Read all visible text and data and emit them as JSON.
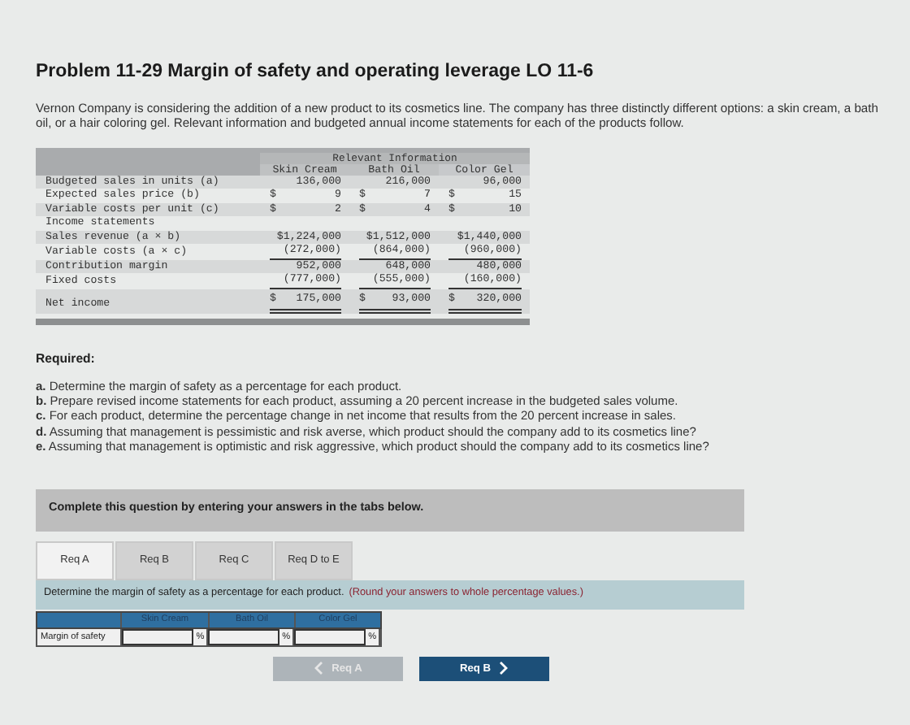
{
  "title": "Problem 11-29 Margin of safety and operating leverage LO 11-6",
  "intro": "Vernon Company is considering the addition of a new product to its cosmetics line. The company has three distinctly different options: a skin cream, a bath oil, or a hair coloring gel. Relevant information and budgeted annual income statements for each of the products follow.",
  "info_table": {
    "group_heading": "Relevant Information",
    "columns": [
      "Skin Cream",
      "Bath Oil",
      "Color Gel"
    ],
    "rows": [
      {
        "label": "Budgeted sales in units (a)",
        "underlined": false,
        "double_underlined": false,
        "values": [
          {
            "value": "136,000"
          },
          {
            "value": "216,000"
          },
          {
            "value": "96,000"
          }
        ]
      },
      {
        "label": "Expected sales price (b)",
        "underlined": false,
        "double_underlined": false,
        "values": [
          {
            "currency": "$",
            "value": "9"
          },
          {
            "currency": "$",
            "value": "7"
          },
          {
            "currency": "$",
            "value": "15"
          }
        ]
      },
      {
        "label": "Variable costs per unit (c)",
        "underlined": false,
        "double_underlined": false,
        "values": [
          {
            "currency": "$",
            "value": "2"
          },
          {
            "currency": "$",
            "value": "4"
          },
          {
            "currency": "$",
            "value": "10"
          }
        ]
      },
      {
        "label": "Income statements"
      },
      {
        "label": "Sales revenue (a × b)",
        "underlined": false,
        "double_underlined": false,
        "values": [
          {
            "value": "$1,224,000"
          },
          {
            "value": "$1,512,000"
          },
          {
            "value": "$1,440,000"
          }
        ]
      },
      {
        "label": "Variable costs (a × c)",
        "underlined": true,
        "double_underlined": false,
        "values": [
          {
            "value": "(272,000)"
          },
          {
            "value": "(864,000)"
          },
          {
            "value": "(960,000)"
          }
        ]
      },
      {
        "label": "Contribution margin",
        "underlined": false,
        "double_underlined": false,
        "values": [
          {
            "value": "952,000"
          },
          {
            "value": "648,000"
          },
          {
            "value": "480,000"
          }
        ]
      },
      {
        "label": "Fixed costs",
        "underlined": true,
        "double_underlined": false,
        "values": [
          {
            "value": "(777,000)"
          },
          {
            "value": "(555,000)"
          },
          {
            "value": "(160,000)"
          }
        ]
      },
      {
        "label": "Net income",
        "underlined": false,
        "double_underlined": true,
        "values": [
          {
            "currency": "$",
            "value": "175,000"
          },
          {
            "currency": "$",
            "value": "93,000"
          },
          {
            "currency": "$",
            "value": "320,000"
          }
        ]
      }
    ]
  },
  "required_heading": "Required:",
  "requirements": [
    {
      "letter": "a.",
      "text": "Determine the margin of safety as a percentage for each product."
    },
    {
      "letter": "b.",
      "text": "Prepare revised income statements for each product, assuming a 20 percent increase in the budgeted sales volume."
    },
    {
      "letter": "c.",
      "text": "For each product, determine the percentage change in net income that results from the 20 percent  increase in sales."
    },
    {
      "letter": "d.",
      "text": "Assuming that management is pessimistic and risk averse, which product should the company add to its cosmetics line?"
    },
    {
      "letter": "e.",
      "text": "Assuming that management is optimistic and risk aggressive, which product should the company add to its cosmetics line?"
    }
  ],
  "instruction_banner": "Complete this question by entering your answers in the tabs below.",
  "tabs": [
    {
      "label": "Req A",
      "selected": true
    },
    {
      "label": "Req B",
      "selected": false
    },
    {
      "label": "Req C",
      "selected": false
    },
    {
      "label": "Req D to E",
      "selected": false
    }
  ],
  "prompt": {
    "text": "Determine the margin of safety as a percentage for each product.",
    "hint": "(Round your answers to whole percentage values.)"
  },
  "answer_table": {
    "columns": [
      "Skin Cream",
      "Bath Oil",
      "Color Gel"
    ],
    "row_label": "Margin of safety",
    "unit": "%"
  },
  "back_button": {
    "label": "Req A",
    "disabled": true
  },
  "next_button": {
    "label": "Req B",
    "disabled": false
  }
}
